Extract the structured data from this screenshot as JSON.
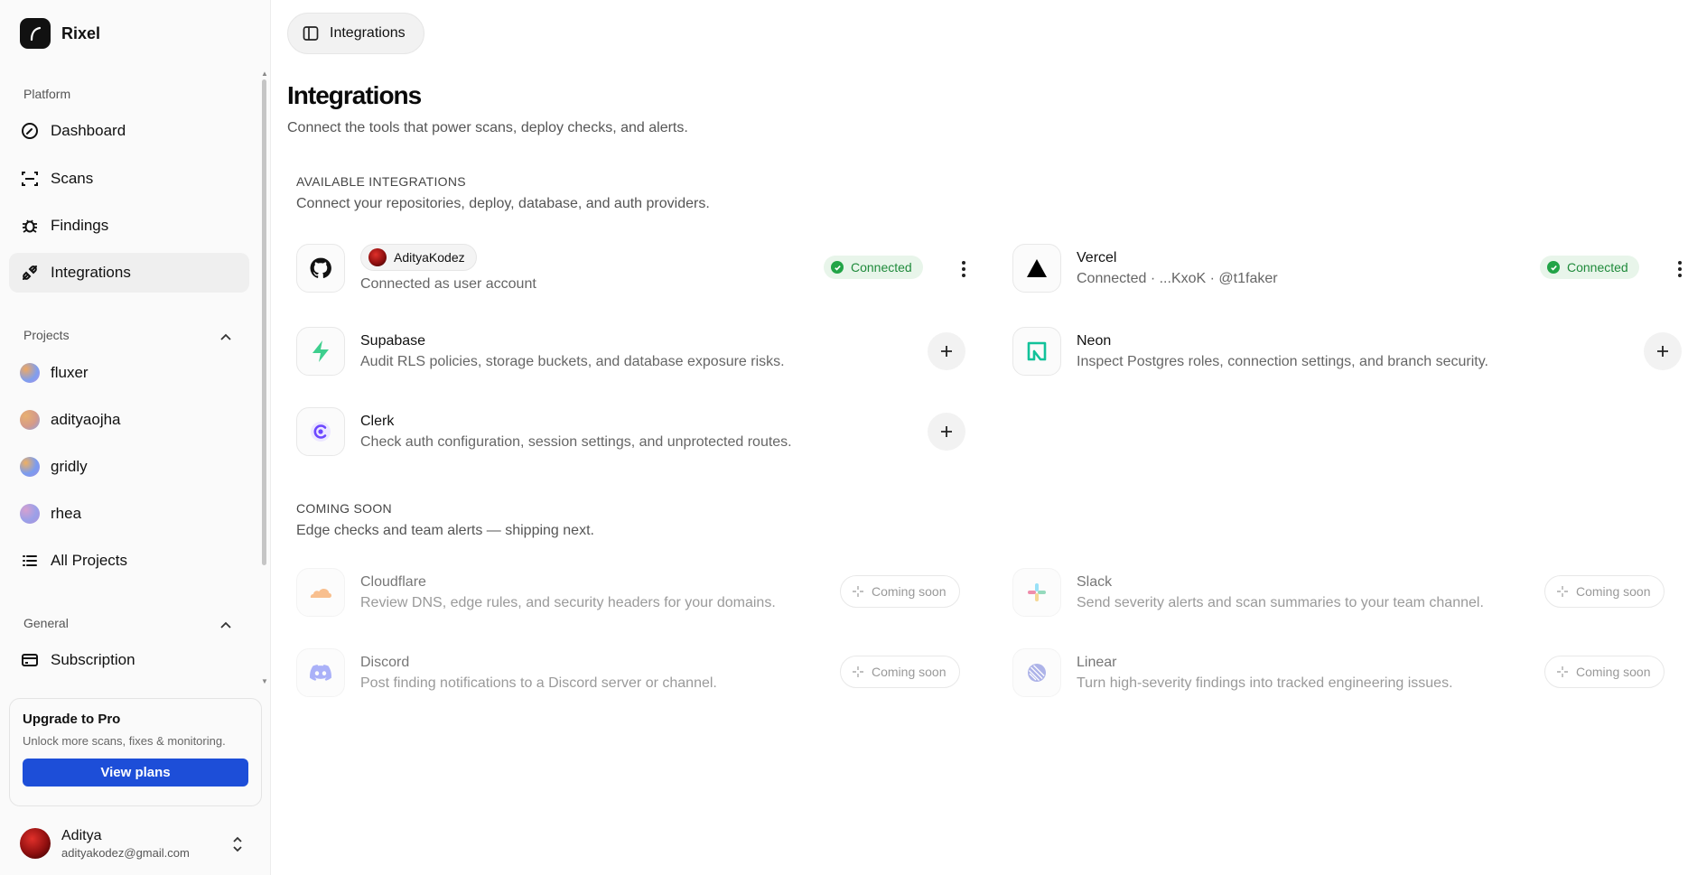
{
  "brand": {
    "name": "Rixel"
  },
  "sidebar": {
    "platform_label": "Platform",
    "platform_items": [
      {
        "label": "Dashboard",
        "icon": "dashboard-icon"
      },
      {
        "label": "Scans",
        "icon": "scan-icon"
      },
      {
        "label": "Findings",
        "icon": "bug-icon"
      },
      {
        "label": "Integrations",
        "icon": "plug-icon",
        "active": true
      }
    ],
    "projects_label": "Projects",
    "projects": [
      {
        "label": "fluxer",
        "color": "#8aa4e6"
      },
      {
        "label": "adityaojha",
        "color": "#d6a86a"
      },
      {
        "label": "gridly",
        "color": "#7fa0e8"
      },
      {
        "label": "rhea",
        "color": "#a58fd8"
      }
    ],
    "all_projects_label": "All Projects",
    "general_label": "General",
    "subscription_label": "Subscription"
  },
  "upgrade": {
    "title": "Upgrade to Pro",
    "subtitle": "Unlock more scans, fixes & monitoring.",
    "button": "View plans"
  },
  "user": {
    "name": "Aditya",
    "email": "adityakodez@gmail.com"
  },
  "header": {
    "crumb": "Integrations"
  },
  "page": {
    "title": "Integrations",
    "subtitle": "Connect the tools that power scans, deploy checks, and alerts."
  },
  "available": {
    "heading": "AVAILABLE INTEGRATIONS",
    "subheading": "Connect your repositories, deploy, database, and auth providers.",
    "github": {
      "chip": "AdityaKodez",
      "desc": "Connected as user account",
      "status": "Connected"
    },
    "vercel": {
      "name": "Vercel",
      "desc": "Connected · ...KxoK · @t1faker",
      "status": "Connected"
    },
    "supabase": {
      "name": "Supabase",
      "desc": "Audit RLS policies, storage buckets, and database exposure risks."
    },
    "neon": {
      "name": "Neon",
      "desc": "Inspect Postgres roles, connection settings, and branch security."
    },
    "clerk": {
      "name": "Clerk",
      "desc": "Check auth configuration, session settings, and unprotected routes."
    }
  },
  "coming": {
    "heading": "COMING SOON",
    "subheading": "Edge checks and team alerts — shipping next.",
    "badge": "Coming soon",
    "cloudflare": {
      "name": "Cloudflare",
      "desc": "Review DNS, edge rules, and security headers for your domains."
    },
    "slack": {
      "name": "Slack",
      "desc": "Send severity alerts and scan summaries to your team channel."
    },
    "discord": {
      "name": "Discord",
      "desc": "Post finding notifications to a Discord server or channel."
    },
    "linear": {
      "name": "Linear",
      "desc": "Turn high-severity findings into tracked engineering issues."
    }
  },
  "colors": {
    "accent": "#1d4ed8",
    "connected_bg": "#e8f5ea",
    "connected_fg": "#1f8a3b"
  }
}
